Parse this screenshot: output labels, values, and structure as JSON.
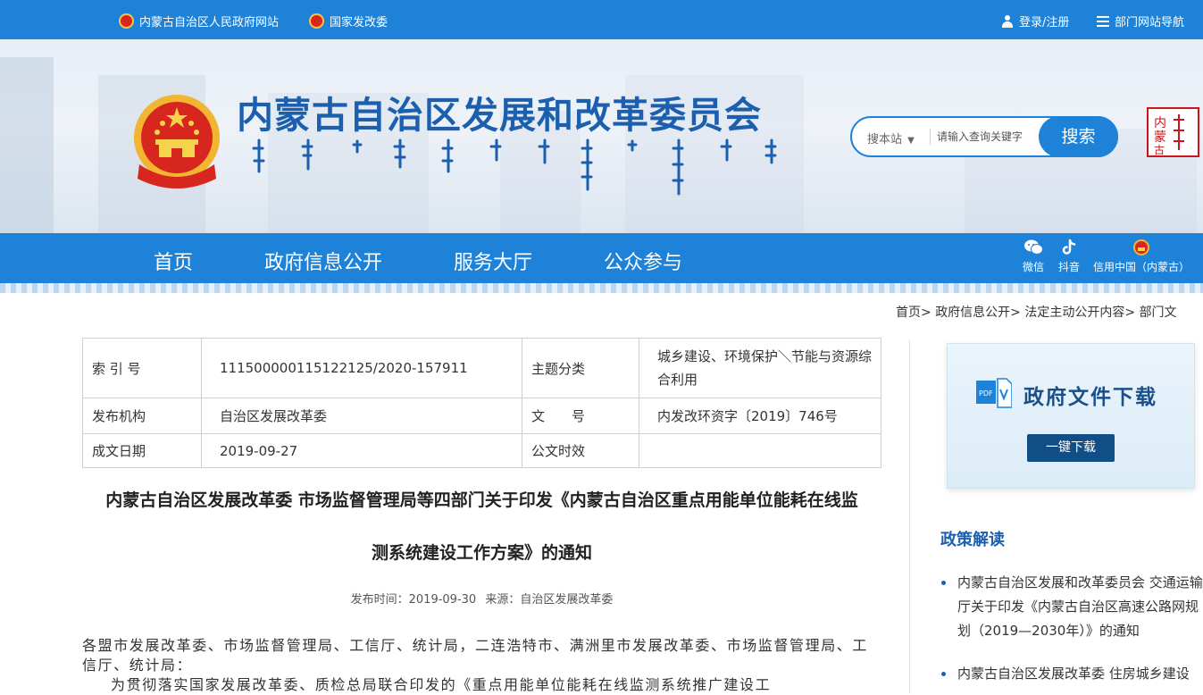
{
  "topbar": {
    "left_links": [
      "内蒙古自治区人民政府网站",
      "国家发改委"
    ],
    "login": "登录/注册",
    "dept_nav": "部门网站导航"
  },
  "header": {
    "title": "内蒙古自治区发展和改革委员会",
    "seal_text": "内蒙古"
  },
  "search": {
    "scope": "搜本站",
    "placeholder": "请输入查询关键字",
    "button": "搜索"
  },
  "nav": {
    "items": [
      "首页",
      "政府信息公开",
      "服务大厅",
      "公众参与"
    ],
    "social": [
      "微信",
      "抖音",
      "信用中国（内蒙古）"
    ]
  },
  "breadcrumb": [
    "首页>",
    "政府信息公开>",
    "法定主动公开内容>",
    "部门文"
  ],
  "info": {
    "index_label": "索 引 号",
    "index_value": "111500000115122125/2020-157911",
    "topic_label": "主题分类",
    "topic_value": "城乡建设、环境保护＼节能与资源综合利用",
    "issuer_label": "发布机构",
    "issuer_value": "自治区发展改革委",
    "docno_label": "文　　号",
    "docno_value": "内发改环资字〔2019〕746号",
    "date_label": "成文日期",
    "date_value": "2019-09-27",
    "validity_label": "公文时效",
    "validity_value": ""
  },
  "article": {
    "title_line1": "内蒙古自治区发展改革委 市场监督管理局等四部门关于印发《内蒙古自治区重点用能单位能耗在线监",
    "title_line2": "测系统建设工作方案》的通知",
    "publish_time": "发布时间：2019-09-30",
    "source": "来源：自治区发展改革委",
    "para1": "各盟市发展改革委、市场监督管理局、工信厅、统计局，二连浩特市、满洲里市发展改革委、市场监督管理局、工信厅、统计局：",
    "para2": "为贯彻落实国家发展改革委、质检总局联合印发的《重点用能单位能耗在线监测系统推广建设工"
  },
  "sidebar": {
    "download_title": "政府文件下载",
    "download_button": "一键下载",
    "section_title": "政策解读",
    "items": [
      "内蒙古自治区发展和改革委员会 交通运输厅关于印发《内蒙古自治区高速公路网规划（2019—2030年）》的通知",
      "内蒙古自治区发展改革委 住房城乡建设"
    ]
  },
  "colors": {
    "primary_blue": "#1e82d8",
    "title_blue": "#1b5fae",
    "dark_button": "#124e86",
    "seal_red": "#c8161d"
  }
}
